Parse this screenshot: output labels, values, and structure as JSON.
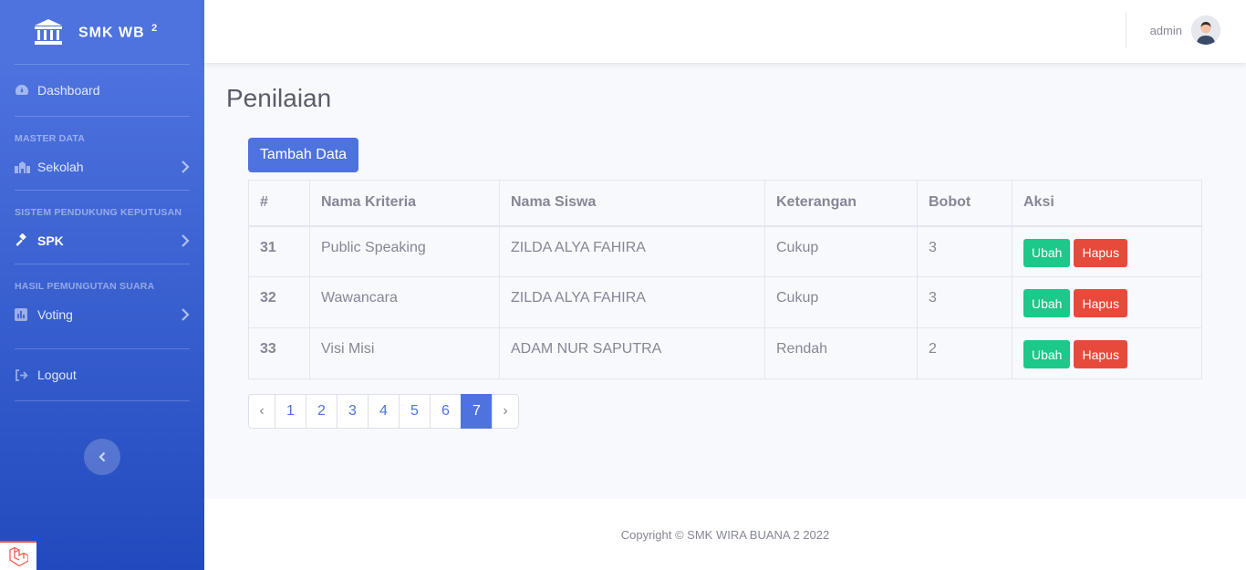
{
  "sidebar": {
    "brand": "SMK WB",
    "brand_sup": "2",
    "dashboard": "Dashboard",
    "headings": [
      "MASTER DATA",
      "SISTEM PENDUKUNG KEPUTUSAN",
      "HASIL PEMUNGUTAN SUARA"
    ],
    "items": [
      "Sekolah",
      "SPK",
      "Voting"
    ],
    "logout": "Logout"
  },
  "topbar": {
    "username": "admin"
  },
  "page": {
    "title": "Penilaian",
    "add_button": "Tambah Data"
  },
  "table": {
    "headers": [
      "#",
      "Nama Kriteria",
      "Nama Siswa",
      "Keterangan",
      "Bobot",
      "Aksi"
    ],
    "rows": [
      [
        "31",
        "Public Speaking",
        "ZILDA ALYA FAHIRA",
        "Cukup",
        "3"
      ],
      [
        "32",
        "Wawancara",
        "ZILDA ALYA FAHIRA",
        "Cukup",
        "3"
      ],
      [
        "33",
        "Visi Misi",
        "ADAM NUR SAPUTRA",
        "Rendah",
        "2"
      ]
    ],
    "edit_label": "Ubah",
    "delete_label": "Hapus"
  },
  "pagination": {
    "prev": "‹",
    "pages": [
      "1",
      "2",
      "3",
      "4",
      "5",
      "6",
      "7"
    ],
    "next": "›",
    "current": "7"
  },
  "footer": {
    "copyright": "Copyright © SMK WIRA BUANA 2 2022"
  },
  "colors": {
    "primary": "#4e73df",
    "success": "#1cc88a",
    "danger": "#e74a3b"
  }
}
